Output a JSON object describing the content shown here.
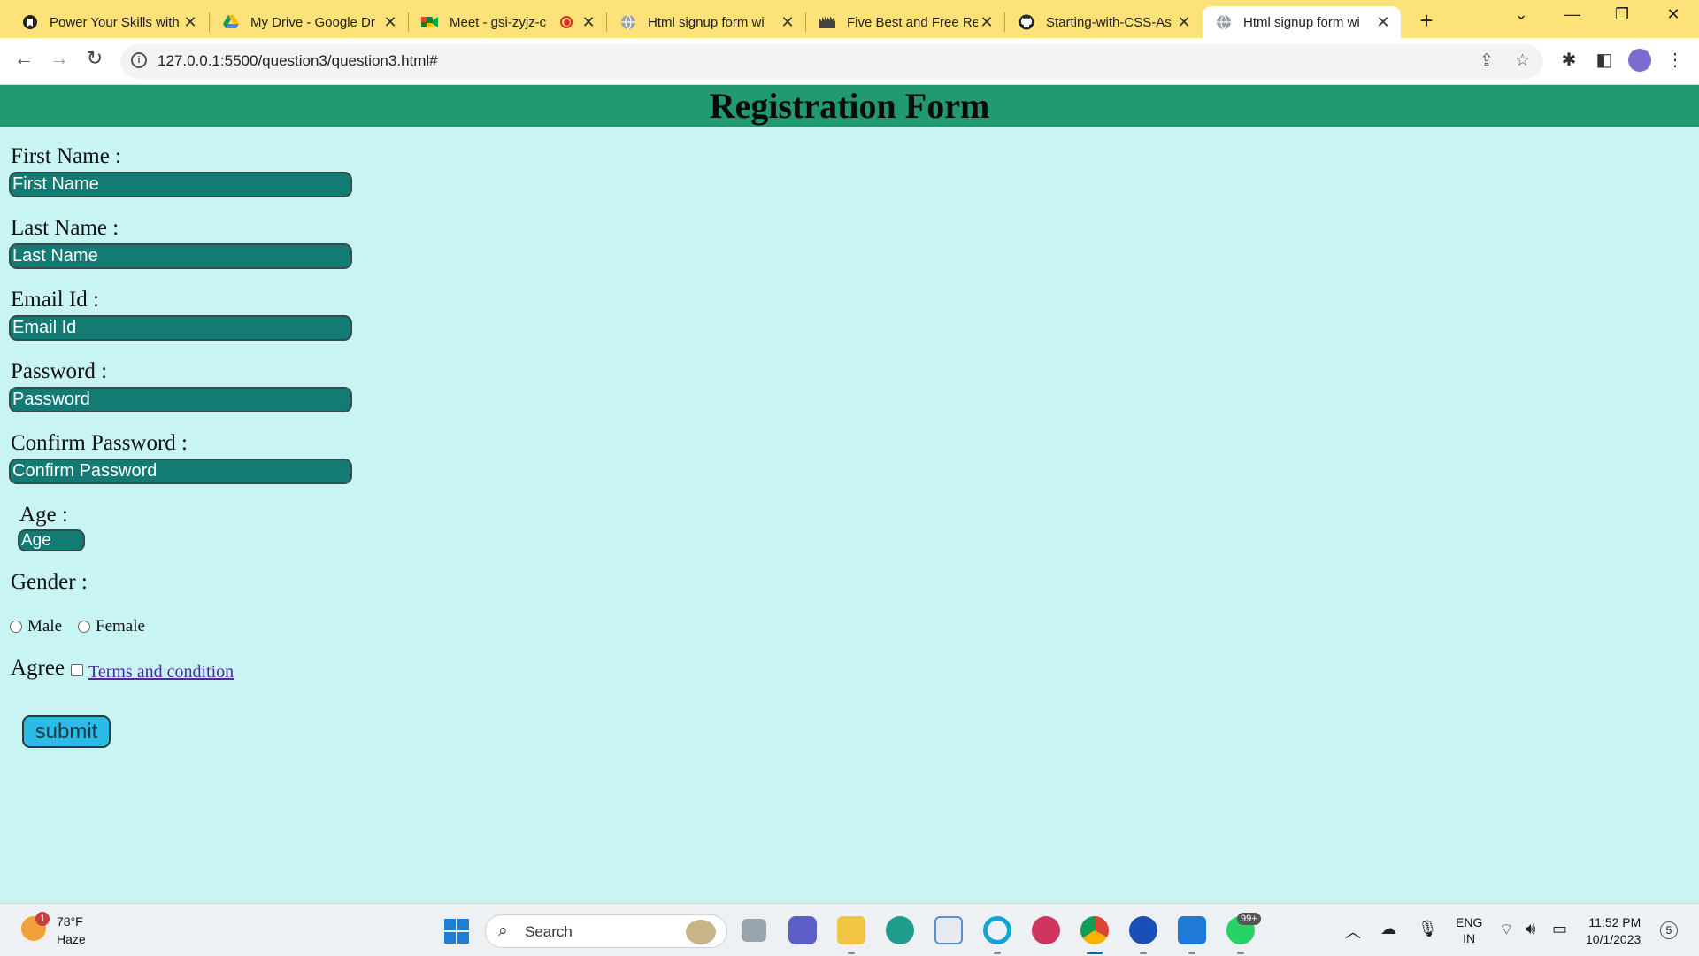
{
  "browser": {
    "tabs": [
      {
        "title": "Power Your Skills with",
        "icon": "bookmark-favicon"
      },
      {
        "title": "My Drive - Google Dr",
        "icon": "google-drive-icon"
      },
      {
        "title": "Meet - gsi-zyjz-c",
        "icon": "google-meet-icon"
      },
      {
        "title": "Html signup form wi",
        "icon": "globe-icon"
      },
      {
        "title": "Five Best and Free Re",
        "icon": "site-favicon"
      },
      {
        "title": "Starting-with-CSS-As",
        "icon": "github-icon"
      },
      {
        "title": "Html signup form wi",
        "icon": "globe-icon"
      }
    ],
    "active_tab_index": 6,
    "url": "127.0.0.1:5500/question3/question3.html#",
    "colors": {
      "tabstrip": "#fde27a",
      "recording_dot": "#d93025"
    }
  },
  "page": {
    "heading": "Registration Form",
    "fields": {
      "first_name": {
        "label": "First Name :",
        "placeholder": "First Name"
      },
      "last_name": {
        "label": "Last Name :",
        "placeholder": "Last Name"
      },
      "email": {
        "label": "Email Id :",
        "placeholder": "Email Id"
      },
      "password": {
        "label": "Password :",
        "placeholder": "Password"
      },
      "confirm_password": {
        "label": "Confirm Password :",
        "placeholder": "Confirm Password"
      },
      "age": {
        "label": "Age :",
        "placeholder": "Age"
      }
    },
    "gender": {
      "label": "Gender :",
      "options": [
        "Male",
        "Female"
      ]
    },
    "agree": {
      "label": "Agree",
      "link_text": "Terms and condition"
    },
    "submit_label": "submit",
    "colors": {
      "header": "#229970",
      "background": "#c8f4f4",
      "input": "#137a74",
      "submit": "#2bbbe6"
    }
  },
  "taskbar": {
    "weather": {
      "temp": "78°F",
      "desc": "Haze",
      "badge": "1"
    },
    "search_text": "Search",
    "app_badge": "99+",
    "lang_top": "ENG",
    "lang_bottom": "IN",
    "time": "11:52 PM",
    "date": "10/1/2023",
    "notifications": "5"
  }
}
